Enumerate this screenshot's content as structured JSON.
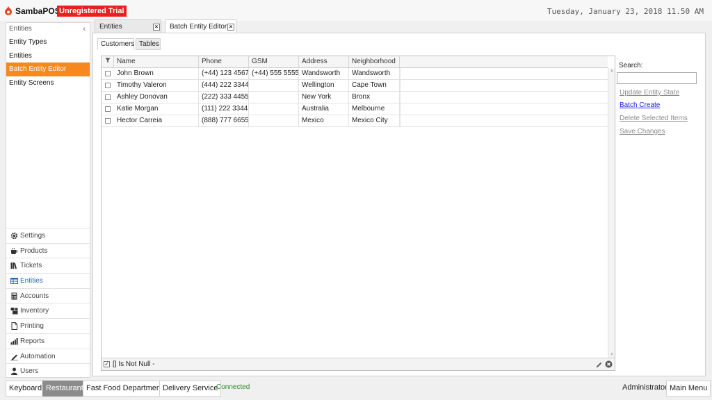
{
  "app": {
    "brand": "SambaPOS",
    "trial_badge": "Unregistered Trial",
    "datetime": "Tuesday, January 23, 2018 11.50 AM"
  },
  "sidebar": {
    "header": "Entities",
    "collapse_glyph": "‹",
    "items": [
      {
        "label": "Entity Types"
      },
      {
        "label": "Entities"
      },
      {
        "label": "Batch Entity Editor",
        "active": true
      },
      {
        "label": "Entity Screens"
      }
    ],
    "sections": [
      {
        "label": "Settings",
        "icon": "gear-icon"
      },
      {
        "label": "Products",
        "icon": "coffee-icon"
      },
      {
        "label": "Tickets",
        "icon": "books-icon"
      },
      {
        "label": "Entities",
        "icon": "table-icon",
        "active": true
      },
      {
        "label": "Accounts",
        "icon": "calculator-icon"
      },
      {
        "label": "Inventory",
        "icon": "inventory-icon"
      },
      {
        "label": "Printing",
        "icon": "document-icon"
      },
      {
        "label": "Reports",
        "icon": "bar-chart-icon"
      },
      {
        "label": "Automation",
        "icon": "pen-icon"
      },
      {
        "label": "Users",
        "icon": "user-icon"
      }
    ]
  },
  "tabs": [
    {
      "label": "Entities",
      "close": "×"
    },
    {
      "label": "Batch Entity Editor",
      "close": "×",
      "active": true
    }
  ],
  "sub_tabs": [
    {
      "label": "Customers",
      "active": true
    },
    {
      "label": "Tables"
    }
  ],
  "grid": {
    "columns": [
      "Name",
      "Phone",
      "GSM",
      "Address",
      "Neighborhood"
    ],
    "rows": [
      [
        "John Brown",
        "(+44) 123 4567",
        "(+44) 555 5555",
        "Wandsworth",
        "Wandsworth"
      ],
      [
        "Timothy Valeron",
        "(444) 222 3344",
        "",
        "Wellington",
        "Cape Town"
      ],
      [
        "Ashley Donovan",
        "(222) 333 4455",
        "",
        "New York",
        "Bronx"
      ],
      [
        "Katie Morgan",
        "(111) 222 3344",
        "",
        "Australia",
        "Melbourne"
      ],
      [
        "Hector Carreia",
        "(888) 777 6655",
        "",
        "Mexico",
        "Mexico City"
      ]
    ],
    "footer_filter": "[] Is Not Null -",
    "footer_check": "✓"
  },
  "commands": {
    "search_label": "Search:",
    "search_value": "",
    "links": [
      {
        "label": "Update Entity State",
        "enabled": false
      },
      {
        "label": "Batch Create",
        "enabled": true
      },
      {
        "label": "Delete Selected Items",
        "enabled": false
      },
      {
        "label": "Save Changes",
        "enabled": false
      }
    ]
  },
  "bottom": {
    "keyboard": "Keyboard",
    "restaurant": "Restaurant",
    "fast_food": "Fast Food Department",
    "delivery": "Delivery Service",
    "status": "Connected",
    "user": "Administrator",
    "main_menu": "Main Menu"
  },
  "colors": {
    "accent": "#f5891f",
    "trial_red": "#e8201f",
    "link_blue": "#2020e0",
    "status_green": "#2e8b2e",
    "active_section": "#2d66b6"
  }
}
